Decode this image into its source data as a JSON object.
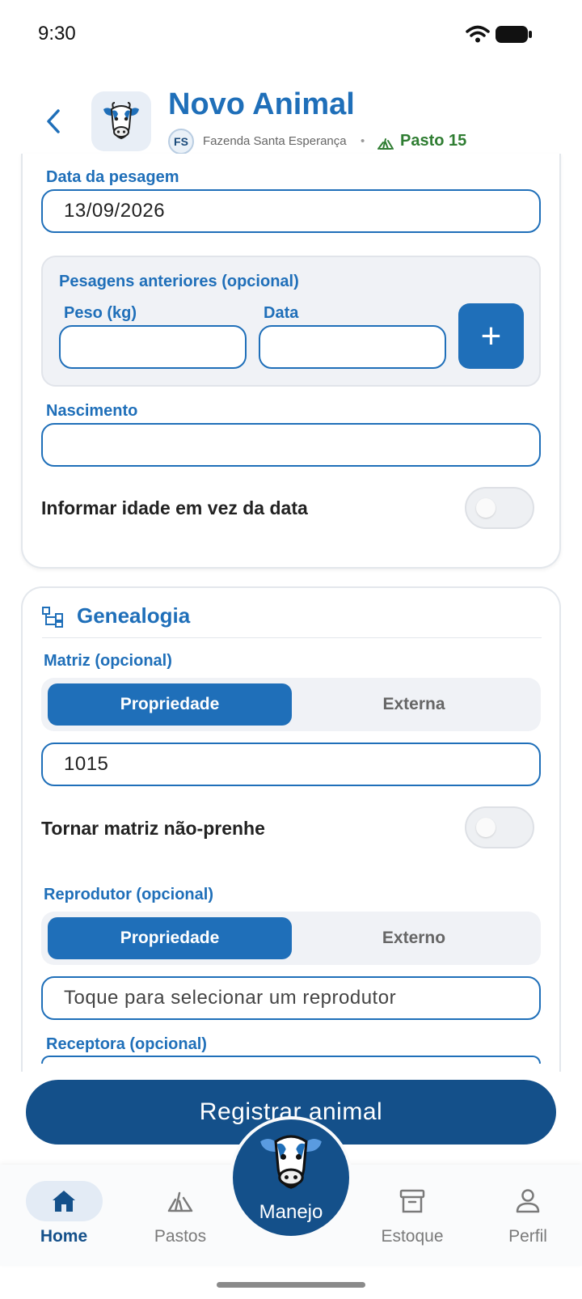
{
  "status_bar": {
    "time": "9:30"
  },
  "header": {
    "title": "Novo Animal",
    "farm_initials": "FS",
    "farm_name": "Fazenda Santa Esperança",
    "separator": "•",
    "pasture": "Pasto 15"
  },
  "weighing": {
    "date_label": "Data da pesagem",
    "date_value": "13/09/2026",
    "previous_title": "Pesagens anteriores (opcional)",
    "weight_label": "Peso (kg)",
    "date_col_label": "Data",
    "add_symbol": "+",
    "birth_label": "Nascimento",
    "birth_value": "",
    "age_toggle_label": "Informar idade em vez da data",
    "age_toggle_on": false
  },
  "genealogy": {
    "title": "Genealogia",
    "dam_label": "Matriz (opcional)",
    "dam_options": [
      "Propriedade",
      "Externa"
    ],
    "dam_selected": "Propriedade",
    "dam_value": "1015",
    "non_pregnant_label": "Tornar matriz não-prenhe",
    "non_pregnant_on": false,
    "sire_label": "Reprodutor (opcional)",
    "sire_options": [
      "Propriedade",
      "Externo"
    ],
    "sire_selected": "Propriedade",
    "sire_placeholder": "Toque para selecionar um reprodutor",
    "recipient_label": "Receptora (opcional)"
  },
  "primary_button": "Registrar animal",
  "bottom_nav": {
    "items": [
      {
        "label": "Home",
        "icon": "home-icon",
        "active": true
      },
      {
        "label": "Pastos",
        "icon": "grass-icon",
        "active": false
      },
      {
        "label": "Manejo",
        "icon": "cow-icon",
        "active": false
      },
      {
        "label": "Estoque",
        "icon": "archive-icon",
        "active": false
      },
      {
        "label": "Perfil",
        "icon": "person-icon",
        "active": false
      }
    ]
  },
  "colors": {
    "primary": "#1f6fb9",
    "primary_dark": "#14508a",
    "pasture_green": "#2f7d32"
  }
}
